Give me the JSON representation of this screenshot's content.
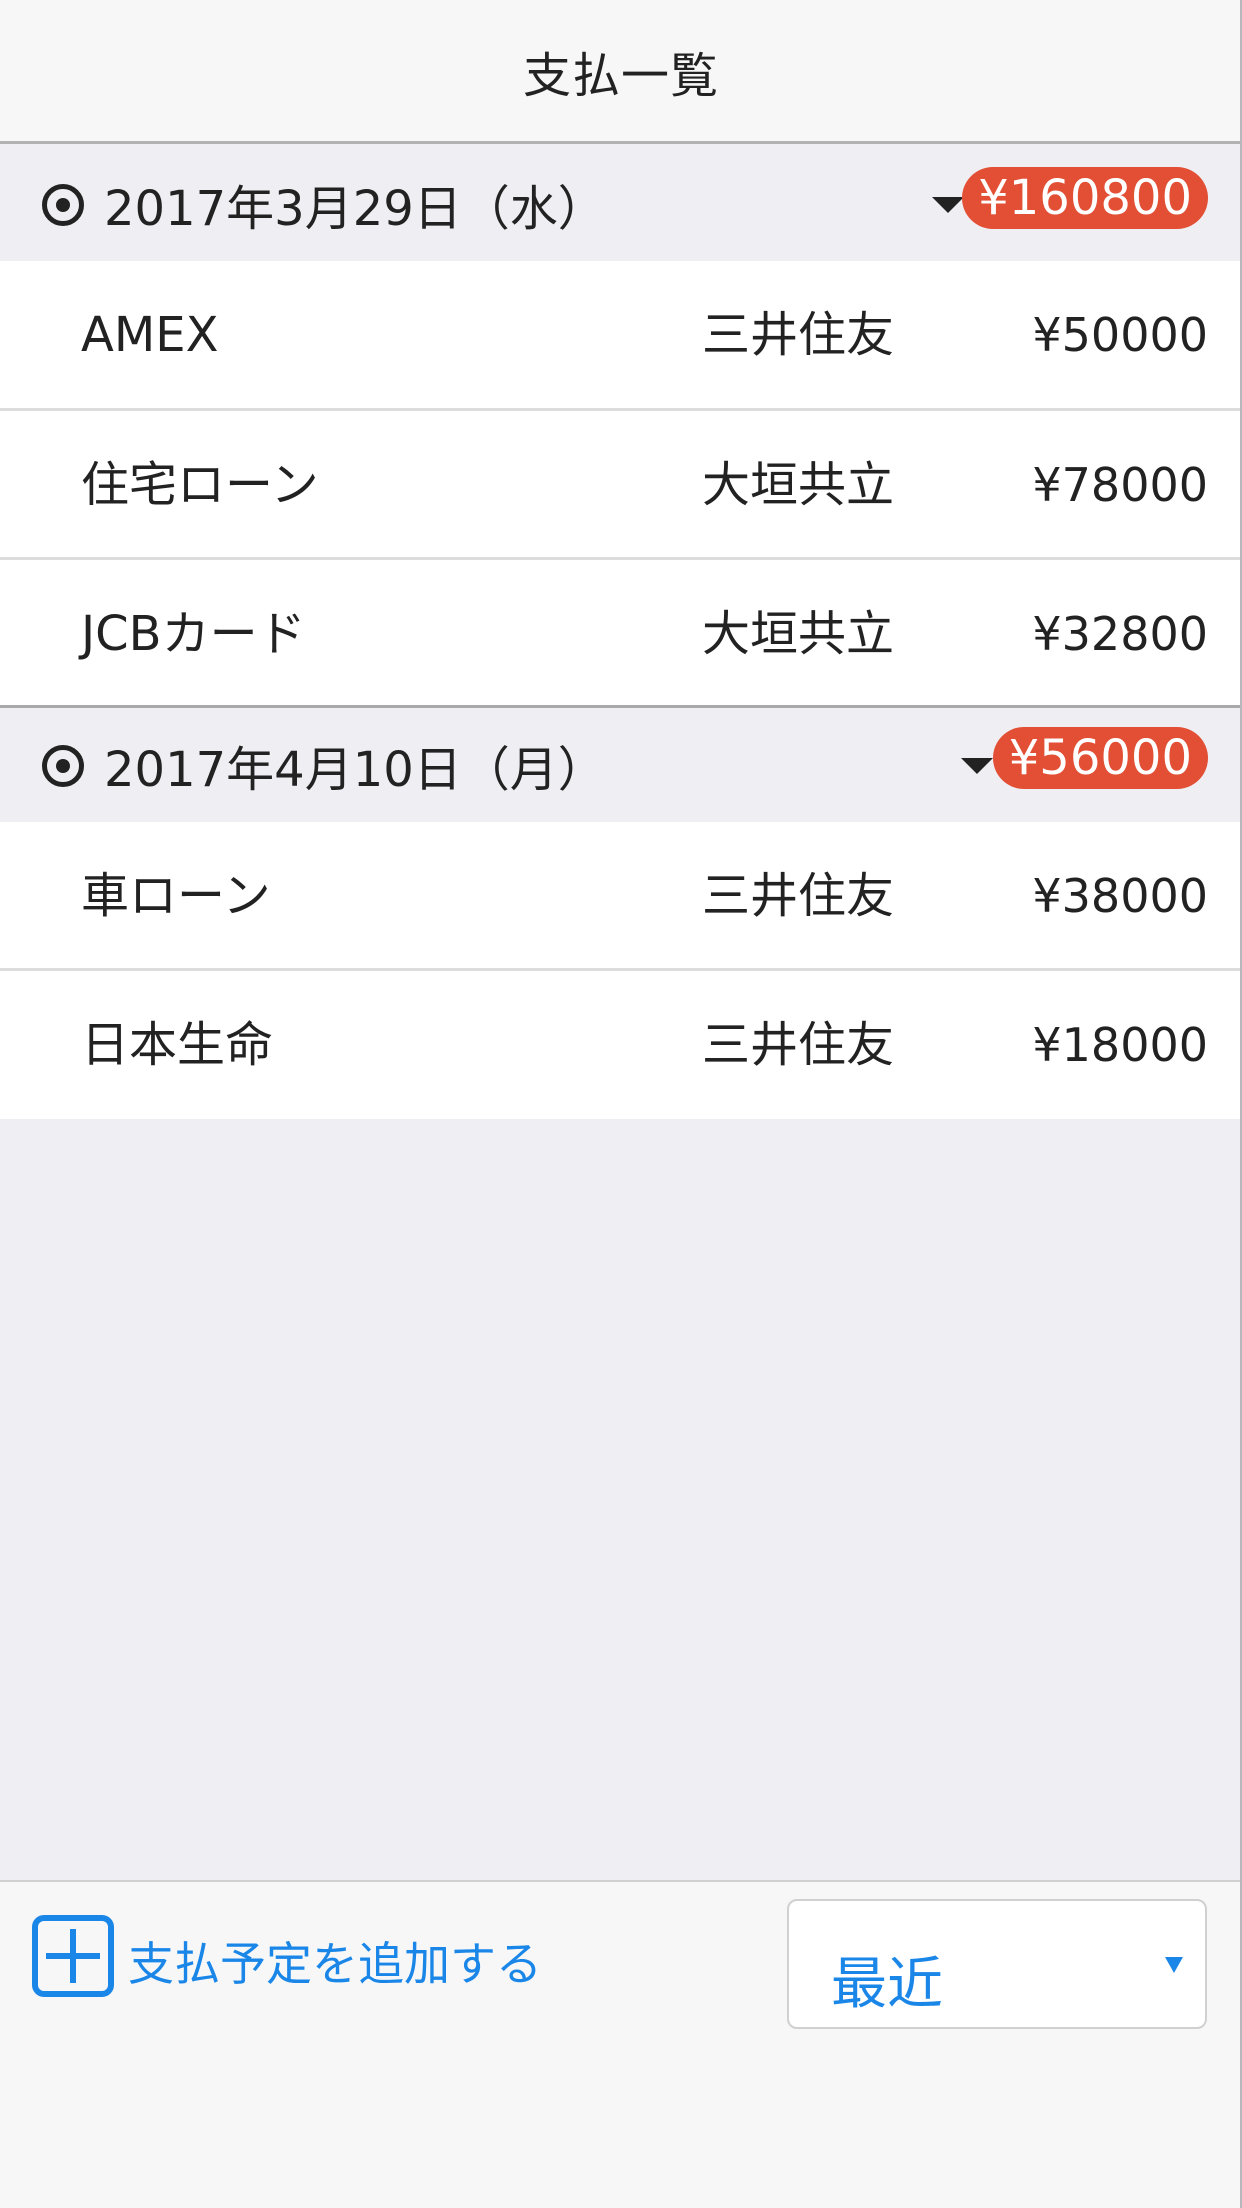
{
  "navbar": {
    "title": "支払一覧"
  },
  "sections": [
    {
      "date": "2017年3月29日（水）",
      "total": "¥160800",
      "rows": [
        {
          "name": "AMEX",
          "bank": "三井住友",
          "amount": "¥50000"
        },
        {
          "name": "住宅ローン",
          "bank": "大垣共立",
          "amount": "¥78000"
        },
        {
          "name": "JCBカード",
          "bank": "大垣共立",
          "amount": "¥32800"
        }
      ]
    },
    {
      "date": "2017年4月10日（月）",
      "total": "¥56000",
      "rows": [
        {
          "name": "車ローン",
          "bank": "三井住友",
          "amount": "¥38000"
        },
        {
          "name": "日本生命",
          "bank": "三井住友",
          "amount": "¥18000"
        }
      ]
    }
  ],
  "toolbar": {
    "add_label": "支払予定を追加する",
    "range_value": "最近"
  },
  "colors": {
    "accent": "#1a86e8",
    "badge": "#e24f35"
  },
  "icons": [
    "radio-dot-icon",
    "caret-down-icon",
    "plus-square-icon"
  ]
}
